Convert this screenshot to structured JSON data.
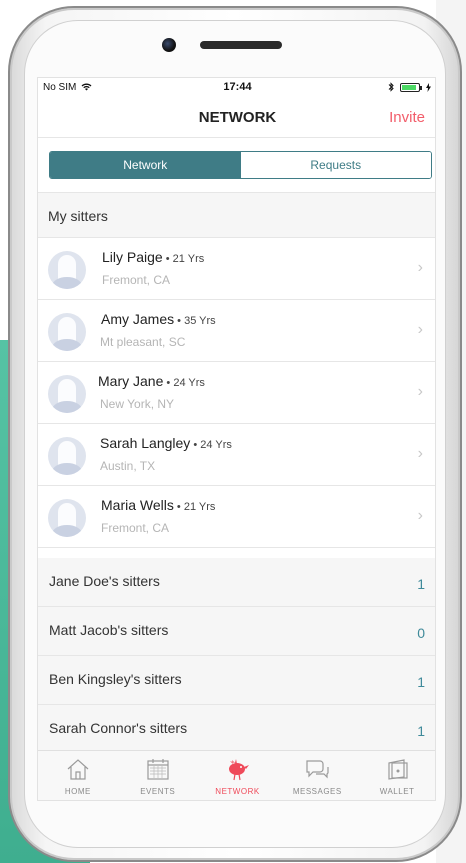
{
  "status_bar": {
    "carrier": "No SIM",
    "time": "17:44"
  },
  "nav": {
    "title": "NETWORK",
    "invite_label": "Invite"
  },
  "segments": {
    "network": "Network",
    "requests": "Requests"
  },
  "my_sitters_header": "My sitters",
  "sitters": [
    {
      "name": "Lily Paige",
      "age": " • 21 Yrs",
      "location": "Fremont, CA"
    },
    {
      "name": "Amy James",
      "age": " • 35 Yrs",
      "location": "Mt pleasant, SC"
    },
    {
      "name": "Mary Jane",
      "age": " • 24 Yrs",
      "location": "New York, NY"
    },
    {
      "name": "Sarah Langley",
      "age": " • 24 Yrs",
      "location": "Austin, TX"
    },
    {
      "name": "Maria Wells",
      "age": " • 21 Yrs",
      "location": "Fremont, CA"
    }
  ],
  "groups": [
    {
      "label": "Jane Doe's sitters",
      "count": "1"
    },
    {
      "label": "Matt Jacob's sitters",
      "count": "0"
    },
    {
      "label": "Ben Kingsley's sitters",
      "count": "1"
    },
    {
      "label": "Sarah Connor's sitters",
      "count": "1"
    }
  ],
  "tabs": [
    {
      "label": "HOME",
      "icon": "home-icon"
    },
    {
      "label": "EVENTS",
      "icon": "calendar-icon"
    },
    {
      "label": "NETWORK",
      "icon": "bird-icon"
    },
    {
      "label": "MESSAGES",
      "icon": "chat-icon"
    },
    {
      "label": "WALLET",
      "icon": "wallet-icon"
    }
  ],
  "colors": {
    "accent_teal": "#3f7c86",
    "accent_red": "#f25d6a",
    "count_teal": "#3f8a9a"
  }
}
